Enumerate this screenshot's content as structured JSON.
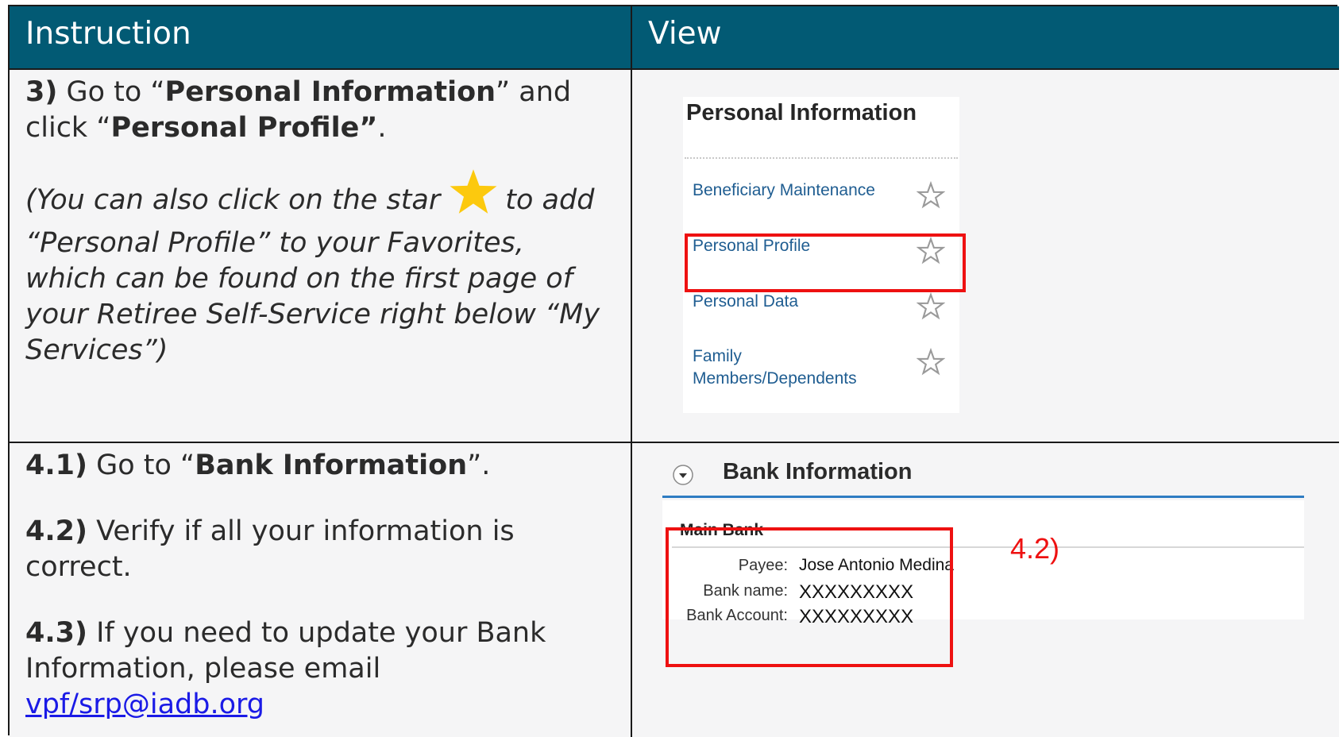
{
  "header": {
    "col1": "Instruction",
    "col2": "View"
  },
  "row1": {
    "instruction": {
      "step": "3)",
      "text_a": " Go to “",
      "bold_a": "Personal Information",
      "text_b": "” and click “",
      "bold_b": "Personal Profile”",
      "text_c": ".",
      "italic_a": "(You can also click on the star",
      "italic_b": "to add “Personal Profile” to your Favorites, which can be found on the first page of your Retiree Self-Service right below “My Services”)"
    },
    "view": {
      "title": "Personal Information",
      "items": [
        {
          "label": "Beneficiary Maintenance"
        },
        {
          "label": "Personal Profile",
          "highlighted": true
        },
        {
          "label": "Personal Data"
        },
        {
          "label": "Family Members/Dependents"
        }
      ],
      "item_icon": "star-outline-icon"
    }
  },
  "row2": {
    "instruction": {
      "s41": "4.1)",
      "s41_text": " Go to “",
      "s41_bold": "Bank Information",
      "s41_end": "”.",
      "s42": "4.2)",
      "s42_text": " Verify if all your information is correct.",
      "s43": "4.3)",
      "s43_text": " If you need to update your Bank Information, please email",
      "email": "vpf/srp@iadb.org"
    },
    "view": {
      "title": "Bank Information",
      "section": "Main Bank",
      "fields": [
        {
          "label": "Payee:",
          "value": "Jose Antonio Medina"
        },
        {
          "label": "Bank name:",
          "value": "XXXXXXXXX"
        },
        {
          "label": "Bank Account:",
          "value": "XXXXXXXXX"
        }
      ],
      "annotation": "4.2)"
    }
  },
  "colors": {
    "header_bg": "#025a74",
    "highlight_red": "#ee1111",
    "link_blue": "#1f5d91",
    "star_gold": "#fcc90e"
  }
}
